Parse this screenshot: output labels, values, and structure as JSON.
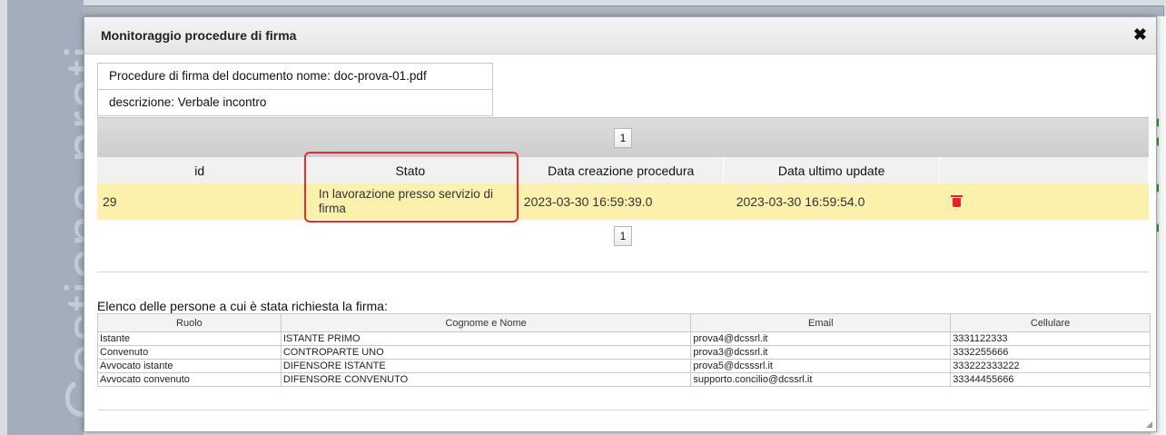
{
  "background": {
    "watermark_text": "Gestione prati"
  },
  "dialog": {
    "title": "Monitoraggio procedure di firma",
    "close_symbol": "✖",
    "document_line": "Procedure di firma del documento nome: doc-prova-01.pdf",
    "description_line": "descrizione: Verbale incontro",
    "pager_top": "1",
    "pager_bottom": "1"
  },
  "procedures_table": {
    "headers": [
      "id",
      "Stato",
      "Data creazione procedura",
      "Data ultimo update"
    ],
    "rows": [
      {
        "id": "29",
        "stato": "In lavorazione presso servizio di firma",
        "created": "2023-03-30 16:59:39.0",
        "updated": "2023-03-30 16:59:54.0",
        "action_icon": "trash-icon"
      }
    ]
  },
  "persons": {
    "title": "Elenco delle persone a cui è stata richiesta la firma:",
    "headers": [
      "Ruolo",
      "Cognome e Nome",
      "Email",
      "Cellulare"
    ],
    "rows": [
      [
        "Istante",
        "ISTANTE PRIMO",
        "prova4@dcssrl.it",
        "3331122333"
      ],
      [
        "Convenuto",
        "CONTROPARTE UNO",
        "prova3@dcssrl.it",
        "3332255666"
      ],
      [
        "Avvocato istante",
        "DIFENSORE ISTANTE",
        "prova5@dcsssrl.it",
        "333222333222"
      ],
      [
        "Avvocato convenuto",
        "DIFENSORE CONVENUTO",
        "supporto.concilio@dcssrl.it",
        "33344455666"
      ]
    ]
  },
  "colors": {
    "row_highlight": "#fbf1ad",
    "callout_border": "#e03030",
    "trash": "#e8222b"
  }
}
